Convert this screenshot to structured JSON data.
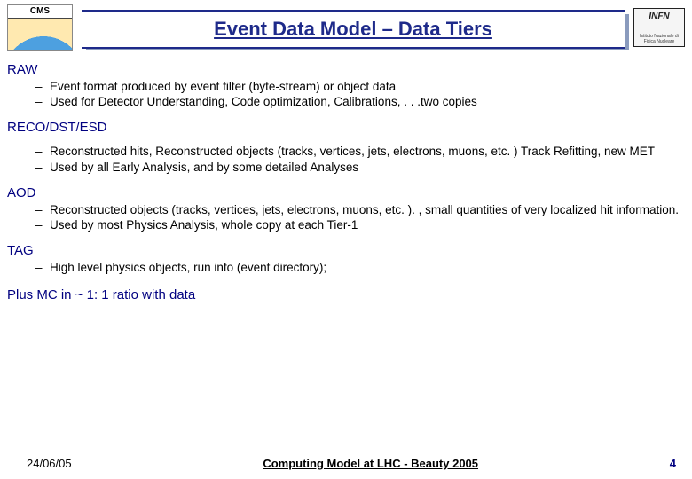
{
  "header": {
    "title": "Event Data Model – Data Tiers",
    "logo_left_label": "CMS",
    "logo_right_label": "INFN",
    "logo_right_sub": "Istituto Nazionale di Fisica Nucleare"
  },
  "tiers": [
    {
      "name": "RAW",
      "bullets": [
        "Event format produced by event filter (byte-stream) or object data",
        "Used for Detector Understanding, Code optimization, Calibrations, . . .two copies"
      ]
    },
    {
      "name": "RECO/DST/ESD",
      "bullets": [
        "Reconstructed hits, Reconstructed objects (tracks, vertices, jets, electrons, muons, etc. ) Track Refitting, new MET",
        "Used by all Early Analysis, and by some detailed Analyses"
      ]
    },
    {
      "name": "AOD",
      "bullets": [
        "Reconstructed objects (tracks, vertices, jets, electrons, muons, etc. ). , small quantities of very localized hit information.",
        "Used by most Physics Analysis, whole copy at each Tier-1"
      ]
    },
    {
      "name": "TAG",
      "bullets": [
        "High level physics objects, run info (event directory);"
      ]
    }
  ],
  "plus_line": "Plus MC in ~ 1: 1 ratio with data",
  "footer": {
    "date": "24/06/05",
    "center": "Computing Model at LHC - Beauty 2005",
    "page": "4"
  }
}
